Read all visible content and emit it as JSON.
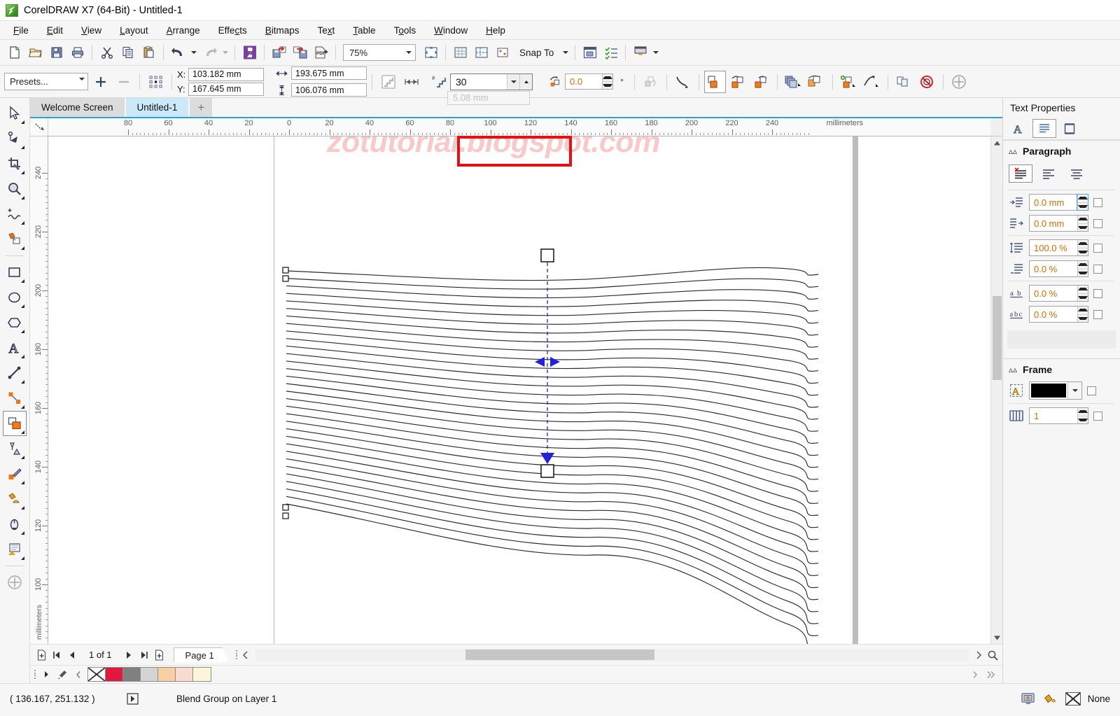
{
  "window": {
    "title": "CorelDRAW X7 (64-Bit) - Untitled-1",
    "logo_icon": "coreldraw-logo-icon"
  },
  "menubar": {
    "items": [
      {
        "label": "File",
        "accel": "F"
      },
      {
        "label": "Edit",
        "accel": "E"
      },
      {
        "label": "View",
        "accel": "V"
      },
      {
        "label": "Layout",
        "accel": "L"
      },
      {
        "label": "Arrange",
        "accel": "A"
      },
      {
        "label": "Effects",
        "accel": "c"
      },
      {
        "label": "Bitmaps",
        "accel": "B"
      },
      {
        "label": "Text",
        "accel": "x"
      },
      {
        "label": "Table",
        "accel": "T"
      },
      {
        "label": "Tools",
        "accel": "o"
      },
      {
        "label": "Window",
        "accel": "W"
      },
      {
        "label": "Help",
        "accel": "H"
      }
    ]
  },
  "toolbar": {
    "new_label": "new-document",
    "open_label": "open",
    "save_label": "save",
    "print_label": "print",
    "cut_label": "cut",
    "copy_label": "copy",
    "paste_label": "paste",
    "undo_label": "undo",
    "redo_label": "redo",
    "connect_label": "corel-connect",
    "import_label": "import",
    "export_label": "export",
    "pdf_label": "publish-to-pdf",
    "zoom_value": "75%",
    "fullscreen_label": "full-screen-preview",
    "options_label": "options",
    "snap_to_label": "Snap To",
    "launch_label": "application-launcher"
  },
  "propertybar": {
    "presets_value": "Presets...",
    "add_preset": "+",
    "remove_preset": "–",
    "x_label": "X:",
    "x_value": "103.182 mm",
    "y_label": "Y:",
    "y_value": "167.645 mm",
    "width_value": "193.675 mm",
    "height_value": "106.076 mm",
    "blend_steps_value": "30",
    "blend_spacing_value": "5.08 mm",
    "rotation_value": "0.0",
    "degree_symbol": "°"
  },
  "tabs": {
    "items": [
      {
        "label": "Welcome Screen",
        "active": false
      },
      {
        "label": "Untitled-1",
        "active": true
      }
    ],
    "add_label": "+"
  },
  "toolbox": {
    "tools": [
      {
        "name": "pick-tool",
        "selected": false
      },
      {
        "name": "shape-tool",
        "selected": false
      },
      {
        "name": "crop-tool",
        "selected": false
      },
      {
        "name": "zoom-tool",
        "selected": false
      },
      {
        "name": "freehand-tool",
        "selected": false
      },
      {
        "name": "smart-fill-tool",
        "selected": false
      },
      {
        "name": "rectangle-tool",
        "selected": false
      },
      {
        "name": "ellipse-tool",
        "selected": false
      },
      {
        "name": "polygon-tool",
        "selected": false
      },
      {
        "name": "text-tool",
        "selected": false
      },
      {
        "name": "parallel-dimension-tool",
        "selected": false
      },
      {
        "name": "straight-line-connector-tool",
        "selected": false
      },
      {
        "name": "blend-tool",
        "selected": true
      },
      {
        "name": "color-eyedropper-tool",
        "selected": false
      },
      {
        "name": "outline-pen-tool",
        "selected": false
      },
      {
        "name": "fill-tool",
        "selected": false
      },
      {
        "name": "interactive-fill-tool",
        "selected": false
      },
      {
        "name": "transparency-tool",
        "selected": false
      }
    ]
  },
  "rulers": {
    "units": "millimeters",
    "horizontal_labels": [
      "80",
      "60",
      "40",
      "20",
      "0",
      "20",
      "40",
      "60",
      "80",
      "100",
      "120",
      "140",
      "160",
      "180",
      "200",
      "220",
      "240"
    ],
    "vertical_labels": [
      "240",
      "220",
      "200",
      "180",
      "160",
      "140",
      "120",
      "100"
    ]
  },
  "canvas": {
    "watermark": "zotutorial.blogspot.com",
    "object_description": "blend-group-of-wavy-curves",
    "blend_step_count": 30
  },
  "pagenav": {
    "page_count_label": "1 of 1",
    "page_tab_label": "Page 1",
    "first_icon": "first-page-icon",
    "prev_icon": "previous-page-icon",
    "next_icon": "next-page-icon",
    "last_icon": "last-page-icon",
    "add_before_icon": "add-page-before-icon",
    "add_after_icon": "add-page-after-icon"
  },
  "palette": {
    "swatches": [
      "none",
      "#e0193f",
      "#808080",
      "#d4d4d4",
      "#f8ceа0",
      "#f9d9cf",
      "#fcf4d6"
    ],
    "swatch_colors": [
      "none",
      "#e0193f",
      "#808080",
      "#d4d4d4",
      "#f7cfa1",
      "#fadbd0",
      "#fdf5d8"
    ]
  },
  "docker": {
    "title": "Text Properties",
    "tabs": [
      {
        "name": "character-tab",
        "active": false
      },
      {
        "name": "paragraph-tab",
        "active": true
      },
      {
        "name": "frame-tab",
        "active": false
      }
    ],
    "paragraph": {
      "section_title": "Paragraph",
      "align_buttons": [
        {
          "name": "no-alignment",
          "active": true
        },
        {
          "name": "align-left",
          "active": false
        },
        {
          "name": "align-center",
          "active": false
        }
      ],
      "fields": [
        {
          "icon": "first-line-indent-icon",
          "value": "0.0 mm"
        },
        {
          "icon": "left-indent-icon",
          "value": "0.0 mm"
        },
        {
          "icon": "line-spacing-icon",
          "value": "100.0 %"
        },
        {
          "icon": "paragraph-spacing-before-icon",
          "value": "0.0 %"
        },
        {
          "icon": "character-spacing-icon",
          "value": "0.0 %"
        },
        {
          "icon": "word-spacing-icon",
          "value": "0.0 %"
        }
      ]
    },
    "frame": {
      "section_title": "Frame",
      "fill_color": "#000000",
      "columns_value": "1"
    }
  },
  "statusbar": {
    "coordinates": "( 136.167, 251.132 )",
    "object_status": "Blend Group on Layer 1",
    "fill_label": "None",
    "document_icon": "document-color-settings-icon",
    "fill_icon": "fill-bucket-icon"
  },
  "colors": {
    "accent_blue": "#29a3e0",
    "tab_active": "#cce9fa",
    "highlight_red": "#e8100f",
    "selection_blue": "#2222dd",
    "orange_value": "#d06c00",
    "watermark_pink": "#f9c9ca"
  }
}
